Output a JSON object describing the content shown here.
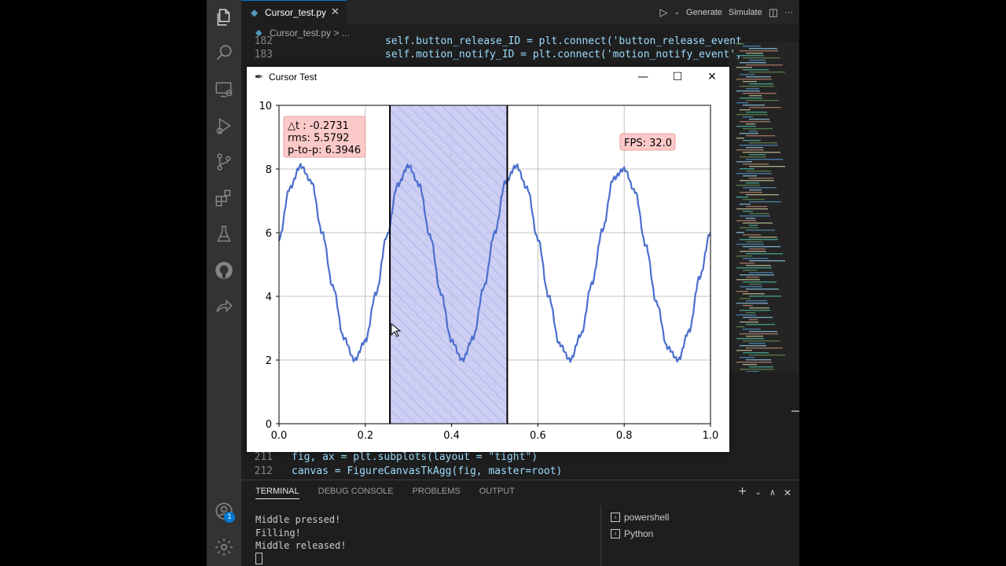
{
  "vscode": {
    "tab": {
      "name": "Cursor_test.py",
      "close": "✕"
    },
    "toolbar": {
      "generate": "Generate",
      "simulate": "Simulate"
    },
    "breadcrumb": "Cursor_test.py > ...",
    "editor_lines": [
      {
        "num": "182",
        "code": "self.button_release_ID = plt.connect('button_release_event"
      },
      {
        "num": "183",
        "code": "self.motion_notify_ID = plt.connect('motion_notify_event',"
      },
      {
        "num": "211",
        "code": "fig, ax = plt.subplots(layout = \"tight\")"
      },
      {
        "num": "212",
        "code": "canvas = FigureCanvasTkAgg(fig, master=root)"
      }
    ],
    "panel": {
      "tabs": [
        "TERMINAL",
        "DEBUG CONSOLE",
        "PROBLEMS",
        "OUTPUT"
      ],
      "active_tab": "TERMINAL",
      "terminal_lines": [
        "Middle pressed!",
        "Filling!",
        "Middle released!"
      ],
      "terminals": [
        "powershell",
        "Python"
      ]
    },
    "accounts_badge": "1"
  },
  "window": {
    "title": "Cursor Test",
    "controls": {
      "minimize": "—",
      "maximize": "☐",
      "close": "✕"
    }
  },
  "chart_data": {
    "type": "line",
    "xlim": [
      0.0,
      1.0
    ],
    "ylim": [
      0,
      10
    ],
    "xticks": [
      "0.0",
      "0.2",
      "0.4",
      "0.6",
      "0.8",
      "1.0"
    ],
    "yticks": [
      "0",
      "2",
      "4",
      "6",
      "8",
      "10"
    ],
    "grid": true,
    "series": [
      {
        "color": "#4c6fce",
        "x": [
          0.0,
          0.025,
          0.05,
          0.075,
          0.1,
          0.125,
          0.15,
          0.175,
          0.2,
          0.225,
          0.25,
          0.275,
          0.3,
          0.325,
          0.35,
          0.375,
          0.4,
          0.425,
          0.45,
          0.475,
          0.5,
          0.525,
          0.55,
          0.575,
          0.6,
          0.625,
          0.65,
          0.675,
          0.7,
          0.725,
          0.75,
          0.775,
          0.8,
          0.825,
          0.85,
          0.875,
          0.9,
          0.925,
          0.95,
          0.975,
          1.0
        ],
        "y": [
          5.8,
          7.4,
          8.1,
          7.6,
          6.0,
          4.3,
          2.7,
          2.0,
          2.6,
          4.1,
          5.9,
          7.5,
          8.1,
          7.5,
          5.9,
          4.1,
          2.6,
          2.0,
          2.7,
          4.3,
          6.0,
          7.6,
          8.1,
          7.4,
          5.8,
          4.0,
          2.5,
          2.0,
          2.8,
          4.4,
          6.1,
          7.7,
          8.0,
          7.3,
          5.6,
          3.8,
          2.4,
          2.0,
          2.9,
          4.6,
          6.0
        ]
      }
    ],
    "span": {
      "x0": 0.257,
      "x1": 0.529,
      "fill": "#c7c9f2",
      "hatch_color": "#9a9ce0"
    },
    "cursor_lines": [
      0.257,
      0.529
    ],
    "stats_box": {
      "lines": [
        "△t : -0.2731",
        "rms: 5.5792",
        "p-to-p: 6.3946"
      ]
    },
    "fps_box": {
      "text": "FPS: 32.0"
    }
  }
}
